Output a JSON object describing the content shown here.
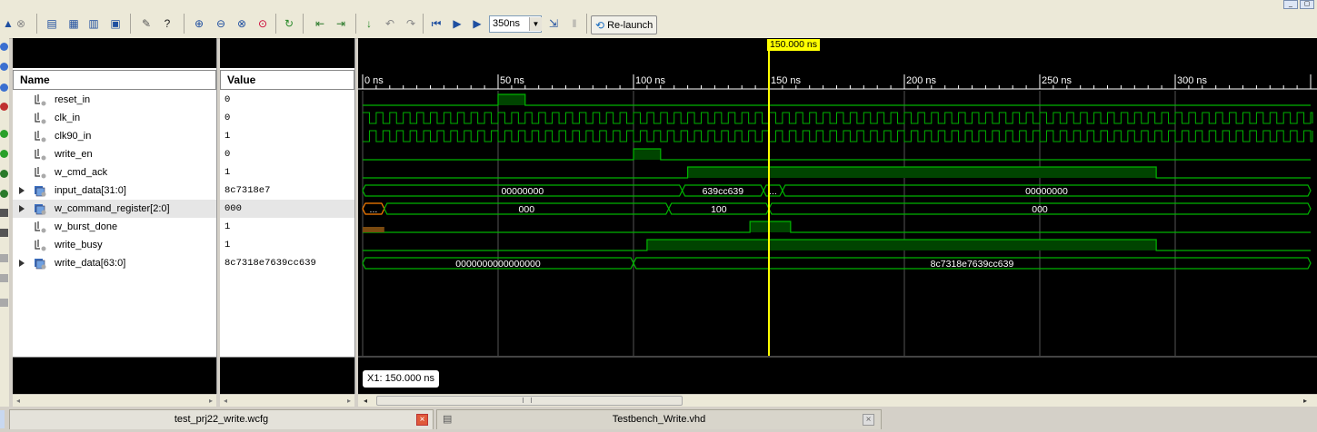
{
  "toolbar": {
    "time_value": "350ns",
    "relaunch_label": "Re-launch",
    "icons": [
      "scroll-up-icon",
      "close-icon",
      "zoom-fit-icon",
      "layout-icon",
      "layout2-icon",
      "float-icon",
      "wrench-icon",
      "whats-this-icon",
      "zoom-in-icon",
      "zoom-out-icon",
      "zoom-full-icon",
      "zoom-area-icon",
      "refresh-icon",
      "prev-marker-icon",
      "next-marker-icon",
      "add-marker-icon",
      "undo-icon",
      "redo-icon",
      "restart-icon",
      "run-icon",
      "run-for-icon",
      "step-icon",
      "pause-icon"
    ]
  },
  "name_header": "Name",
  "value_header": "Value",
  "signals": [
    {
      "name": "reset_in",
      "value": "0",
      "bus": false
    },
    {
      "name": "clk_in",
      "value": "0",
      "bus": false
    },
    {
      "name": "clk90_in",
      "value": "1",
      "bus": false
    },
    {
      "name": "write_en",
      "value": "0",
      "bus": false
    },
    {
      "name": "w_cmd_ack",
      "value": "1",
      "bus": false
    },
    {
      "name": "input_data[31:0]",
      "value": "8c7318e7",
      "bus": true
    },
    {
      "name": "w_command_register[2:0]",
      "value": "000",
      "bus": true
    },
    {
      "name": "w_burst_done",
      "value": "1",
      "bus": false
    },
    {
      "name": "write_busy",
      "value": "1",
      "bus": false
    },
    {
      "name": "write_data[63:0]",
      "value": "8c7318e7639cc639",
      "bus": true
    }
  ],
  "time_axis": {
    "unit": "ns",
    "labels": [
      "0 ns",
      "50 ns",
      "100 ns",
      "150 ns",
      "200 ns",
      "250 ns",
      "300 ns"
    ],
    "range_ns": [
      0,
      350
    ]
  },
  "cursor": {
    "time_ns": 150,
    "flag_label": "150.000 ns",
    "readout_label": "X1: 150.000 ns",
    "color": "#ffff00"
  },
  "waves": {
    "color": "#00b400",
    "fill_color": "#004400",
    "clock_half_period_ns": 2.5,
    "reset_in": [
      [
        0,
        0
      ],
      [
        50,
        1
      ],
      [
        60,
        0
      ]
    ],
    "write_en": [
      [
        0,
        0
      ],
      [
        100,
        1
      ],
      [
        110,
        0
      ]
    ],
    "w_cmd_ack": [
      [
        0,
        0
      ],
      [
        120,
        1
      ],
      [
        293,
        0
      ]
    ],
    "w_burst_done": [
      [
        0,
        0
      ],
      [
        143,
        1
      ],
      [
        158,
        0
      ]
    ],
    "write_busy": [
      [
        0,
        0
      ],
      [
        105,
        1
      ],
      [
        293,
        0
      ]
    ],
    "input_data": [
      {
        "from": 0,
        "to": 118,
        "label": "00000000"
      },
      {
        "from": 118,
        "to": 148,
        "label": "639cc639"
      },
      {
        "from": 148,
        "to": 155,
        "label": "..."
      },
      {
        "from": 155,
        "to": 350,
        "label": "00000000"
      }
    ],
    "w_command_register": [
      {
        "from": 0,
        "to": 8,
        "label": "...",
        "color": "#ff7f00"
      },
      {
        "from": 8,
        "to": 113,
        "label": "000"
      },
      {
        "from": 113,
        "to": 150,
        "label": "100"
      },
      {
        "from": 150,
        "to": 350,
        "label": "000"
      }
    ],
    "write_data": [
      {
        "from": 0,
        "to": 100,
        "label": "0000000000000000"
      },
      {
        "from": 100,
        "to": 350,
        "label": "8c7318e7639cc639"
      }
    ]
  },
  "tabs": [
    {
      "label": "test_prj22_write.wcfg",
      "active": true
    },
    {
      "label": "Testbench_Write.vhd",
      "active": false
    }
  ]
}
